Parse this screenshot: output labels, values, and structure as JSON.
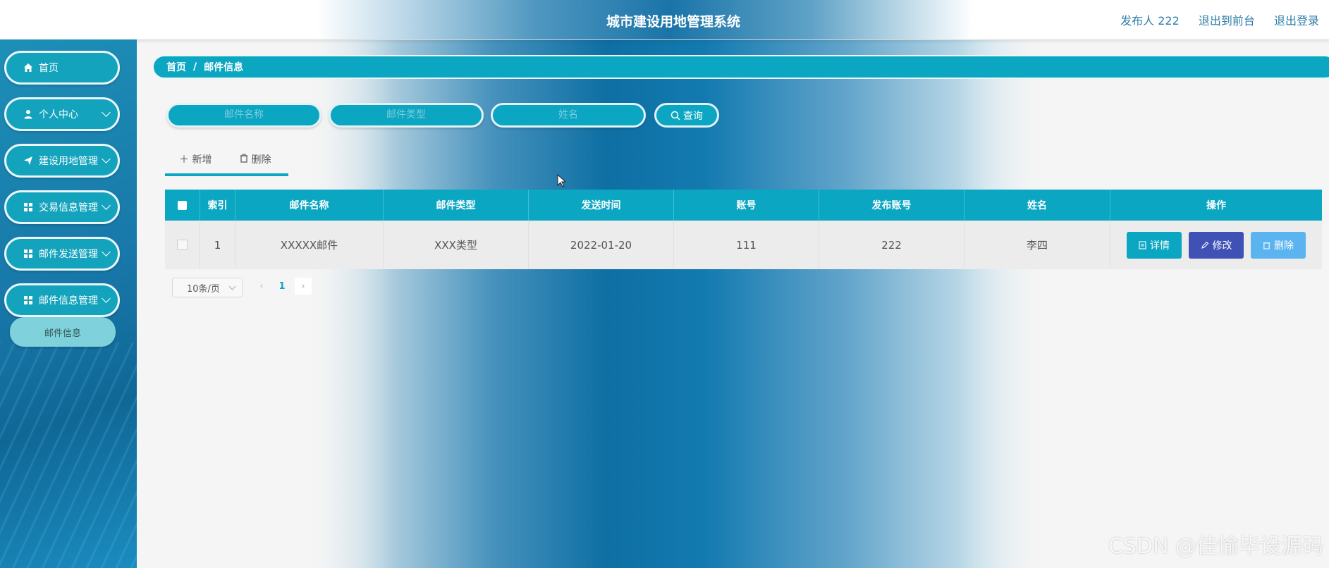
{
  "header": {
    "title": "城市建设用地管理系统",
    "publisher": "发布人 222",
    "to_frontend": "退出到前台",
    "logout": "退出登录"
  },
  "sidebar": {
    "items": [
      {
        "label": "首页",
        "icon": "home-icon"
      },
      {
        "label": "个人中心",
        "icon": "user-icon"
      },
      {
        "label": "建设用地管理",
        "icon": "send-icon"
      },
      {
        "label": "交易信息管理",
        "icon": "grid-icon"
      },
      {
        "label": "邮件发送管理",
        "icon": "grid-icon"
      },
      {
        "label": "邮件信息管理",
        "icon": "grid-icon"
      }
    ],
    "submenu": "邮件信息"
  },
  "breadcrumb": {
    "home": "首页",
    "separator": "/",
    "current": "邮件信息"
  },
  "search": {
    "mail_name_placeholder": "邮件名称",
    "mail_type_placeholder": "邮件类型",
    "name_placeholder": "姓名",
    "query_label": "查询"
  },
  "actions": {
    "add_label": "新增",
    "delete_label": "删除"
  },
  "table": {
    "headers": [
      "索引",
      "邮件名称",
      "邮件类型",
      "发送时间",
      "账号",
      "发布账号",
      "姓名",
      "操作"
    ],
    "rows": [
      {
        "index": "1",
        "mail_name": "XXXXX邮件",
        "mail_type": "XXX类型",
        "send_time": "2022-01-20",
        "account": "111",
        "publish_account": "222",
        "name": "李四"
      }
    ],
    "row_buttons": {
      "detail": "详情",
      "edit": "修改",
      "delete": "删除"
    }
  },
  "pagination": {
    "page_size": "10条/页",
    "current_page": "1"
  },
  "watermark": "CSDN @佳愉毕设源码",
  "colors": {
    "accent": "#0ba6c2",
    "edit": "#3f51b5",
    "delete": "#5bb4f0",
    "detail": "#0ba6c2"
  }
}
